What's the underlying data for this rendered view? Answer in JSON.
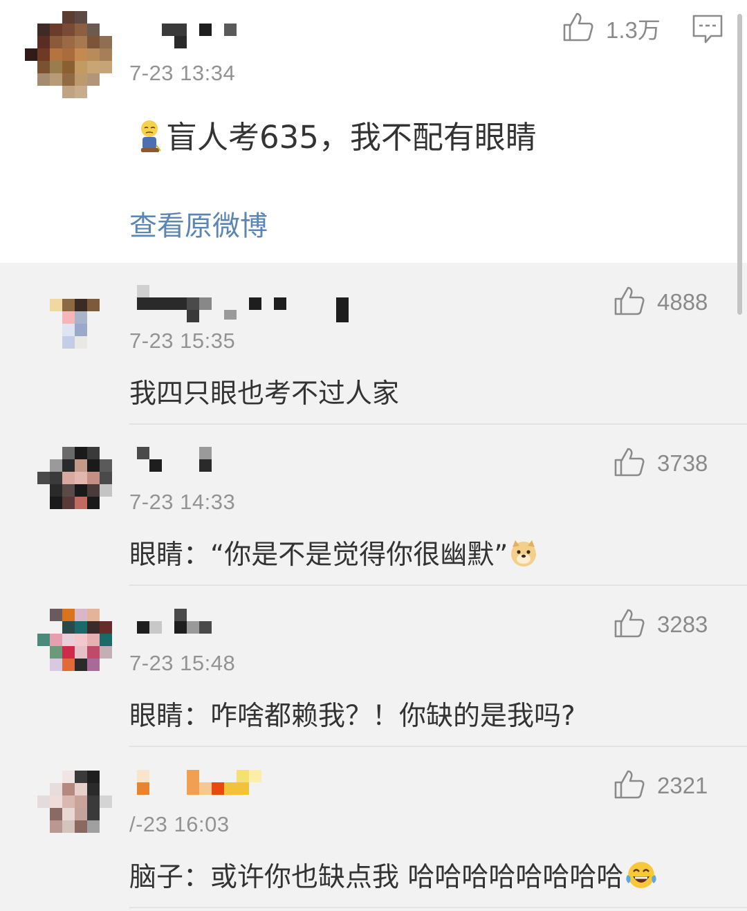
{
  "post": {
    "time": "7-23 13:34",
    "text": "盲人考635，我不配有眼睛",
    "emoji_icon": "blind-person-emoji-icon",
    "like_count": "1.3万",
    "view_original": "查看原微博"
  },
  "replies": [
    {
      "time": "7-23 15:35",
      "text": "我四只眼也考不过人家",
      "likes": "4888"
    },
    {
      "time": "7-23 14:33",
      "text": "眼睛：“你是不是觉得你很幽默”",
      "likes": "3738",
      "emoji_icon": "doge-emoji-icon"
    },
    {
      "time": "7-23 15:48",
      "text": "眼睛：咋啥都赖我？！你缺的是我吗?",
      "likes": "3283"
    },
    {
      "time": "/-23 16:03",
      "text": "脑子：或许你也缺点我 哈哈哈哈哈哈哈哈",
      "likes": "2321",
      "emoji_icon": "laughing-tears-emoji-icon"
    }
  ],
  "colors": {
    "background": "#f2f2f2",
    "card": "#ffffff",
    "link": "#5b85b5",
    "meta_text": "#939393"
  }
}
